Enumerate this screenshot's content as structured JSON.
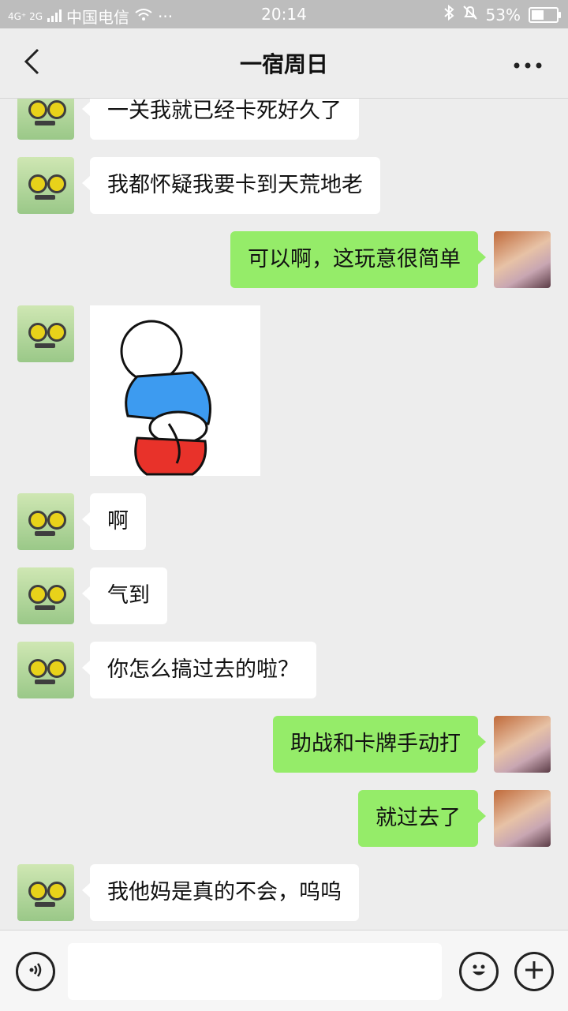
{
  "status_bar": {
    "network": "4G⁺ 2G",
    "carrier": "中国电信",
    "dots": "···",
    "time": "20:14",
    "battery_text": "53%",
    "battery_level": 0.53
  },
  "header": {
    "title": "一宿周日"
  },
  "messages": [
    {
      "side": "them",
      "type": "text",
      "text": "一关我就已经卡死好久了"
    },
    {
      "side": "them",
      "type": "text",
      "text": "我都怀疑我要卡到天荒地老"
    },
    {
      "side": "me",
      "type": "text",
      "text": "可以啊，这玩意很简单"
    },
    {
      "side": "them",
      "type": "sticker",
      "text": ""
    },
    {
      "side": "them",
      "type": "text",
      "text": "啊"
    },
    {
      "side": "them",
      "type": "text",
      "text": "气到"
    },
    {
      "side": "them",
      "type": "text",
      "text": "你怎么搞过去的啦？"
    },
    {
      "side": "me",
      "type": "text",
      "text": "助战和卡牌手动打"
    },
    {
      "side": "me",
      "type": "text",
      "text": "就过去了"
    },
    {
      "side": "them",
      "type": "text",
      "text": "我他妈是真的不会，呜呜"
    }
  ],
  "input": {
    "value": "",
    "placeholder": ""
  },
  "icons": {
    "back": "back-arrow-icon",
    "more": "more-dots-icon",
    "voice": "voice-icon",
    "emoji": "emoji-icon",
    "plus": "plus-icon"
  },
  "colors": {
    "my_bubble": "#95ec69",
    "their_bubble": "#ffffff",
    "background": "#ededed"
  }
}
